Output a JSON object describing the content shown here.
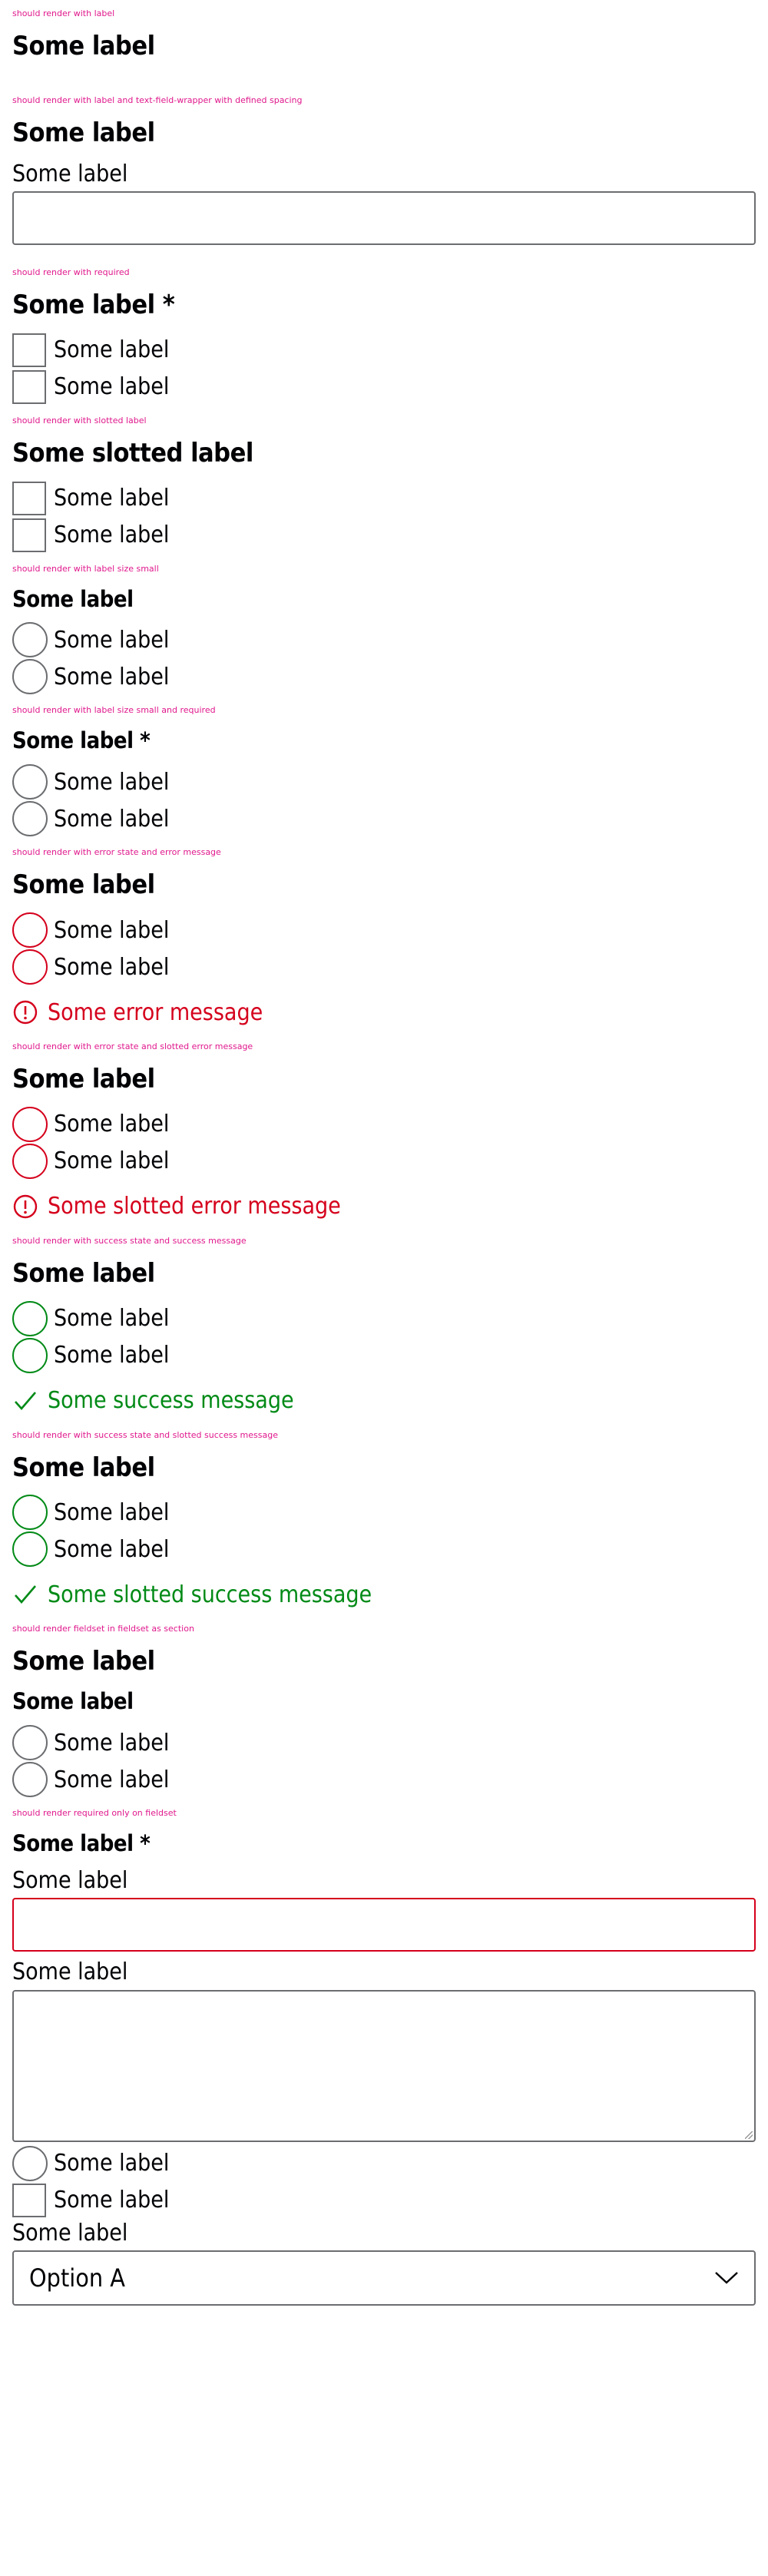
{
  "sections": {
    "s1": {
      "caption": "should render with label",
      "legend": "Some label"
    },
    "s2": {
      "caption": "should render with label and text-field-wrapper with defined spacing",
      "legend": "Some label",
      "field_label": "Some label"
    },
    "s3": {
      "caption": "should render with required",
      "legend": "Some label *",
      "options": [
        "Some label",
        "Some label"
      ]
    },
    "s4": {
      "caption": "should render with slotted label",
      "legend": "Some slotted label",
      "options": [
        "Some label",
        "Some label"
      ]
    },
    "s5": {
      "caption": "should render with label size small",
      "legend": "Some label",
      "options": [
        "Some label",
        "Some label"
      ]
    },
    "s6": {
      "caption": "should render with label size small and required",
      "legend": "Some label *",
      "options": [
        "Some label",
        "Some label"
      ]
    },
    "s7": {
      "caption": "should render with error state and error message",
      "legend": "Some label",
      "options": [
        "Some label",
        "Some label"
      ],
      "message": "Some error message"
    },
    "s8": {
      "caption": "should render with error state and slotted error message",
      "legend": "Some label",
      "options": [
        "Some label",
        "Some label"
      ],
      "message": "Some slotted error message"
    },
    "s9": {
      "caption": "should render with success state and success message",
      "legend": "Some label",
      "options": [
        "Some label",
        "Some label"
      ],
      "message": "Some success message"
    },
    "s10": {
      "caption": "should render with success state and slotted success message",
      "legend": "Some label",
      "options": [
        "Some label",
        "Some label"
      ],
      "message": "Some slotted success message"
    },
    "s11": {
      "caption": "should render fieldset in fieldset as section",
      "legend": "Some label",
      "sub_legend": "Some label",
      "options": [
        "Some label",
        "Some label"
      ]
    },
    "s12": {
      "caption": "should render required only on fieldset",
      "legend": "Some label *",
      "input_label": "Some label",
      "textarea_label": "Some label",
      "radio_label": "Some label",
      "checkbox_label": "Some label",
      "select_label": "Some label",
      "select_value": "Option A"
    }
  },
  "colors": {
    "caption": "#e0188c",
    "error": "#d5001c",
    "success": "#018a16",
    "border": "#6b6d70"
  },
  "icons": {
    "error": "exclamation-circle-icon",
    "success": "check-icon",
    "select": "chevron-down-icon"
  }
}
